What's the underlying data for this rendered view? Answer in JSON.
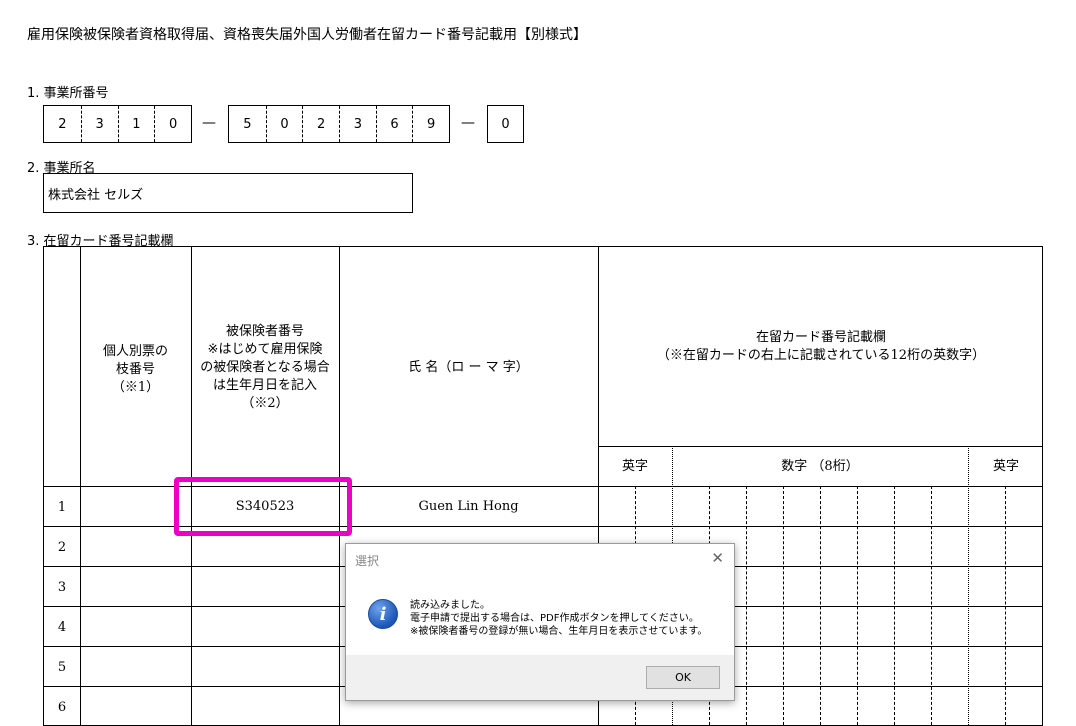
{
  "title": "雇用保険被保険者資格取得届、資格喪失届外国人労働者在留カード番号記載用【別様式】",
  "section1": {
    "label": "1. 事業所番号",
    "group1": [
      "2",
      "3",
      "1",
      "0"
    ],
    "group2": [
      "5",
      "0",
      "2",
      "3",
      "6",
      "9"
    ],
    "group3": [
      "0"
    ],
    "separator": "—"
  },
  "section2": {
    "label": "2. 事業所名",
    "value": "株式会社 セルズ"
  },
  "section3": {
    "label": "3. 在留カード番号記載欄"
  },
  "table": {
    "col_branch_header": "個人別票の\n枝番号\n（※1）",
    "col_insured_header": "被保険者番号\n※はじめて雇用保険\nの被保険者となる場合\nは生年月日を記入\n（※2）",
    "col_name_header": "氏 名（ロ ー マ 字）",
    "col_card_header": "在留カード番号記載欄\n（※在留カードの右上に記載されている12桁の英数字）",
    "sub_alpha_left": "英字",
    "sub_digits": "数字 （8桁）",
    "sub_alpha_right": "英字",
    "rows": [
      {
        "no": "1",
        "insured": "S340523",
        "name": "Guen Lin Hong"
      },
      {
        "no": "2",
        "insured": "",
        "name": ""
      },
      {
        "no": "3",
        "insured": "",
        "name": ""
      },
      {
        "no": "4",
        "insured": "",
        "name": ""
      },
      {
        "no": "5",
        "insured": "",
        "name": ""
      },
      {
        "no": "6",
        "insured": "",
        "name": ""
      }
    ]
  },
  "dialog": {
    "title": "選択",
    "close": "✕",
    "icon": "information-icon",
    "icon_glyph": "i",
    "message": "読み込みました。\n電子申請で提出する場合は、PDF作成ボタンを押してください。\n※被保険者番号の登録が無い場合、生年月日を表示させています。",
    "ok_label": "OK"
  },
  "colors": {
    "highlight": "#ee00c8",
    "info_icon": "#1c56b8"
  }
}
